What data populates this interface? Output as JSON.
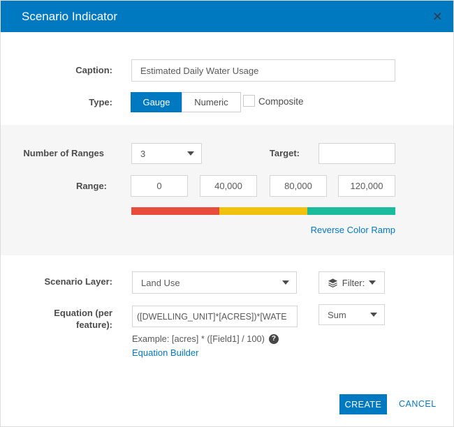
{
  "dialog": {
    "title": "Scenario Indicator",
    "close_glyph": "×"
  },
  "colors": {
    "accent": "#0079c1",
    "ramp_red": "#e74c3c",
    "ramp_yellow": "#f0c20e",
    "ramp_green": "#1abc9c",
    "panel_bg": "#f6f6f6"
  },
  "caption": {
    "label": "Caption:",
    "value": "Estimated Daily Water Usage"
  },
  "type": {
    "label": "Type:",
    "gauge_label": "Gauge",
    "numeric_label": "Numeric",
    "selected": "Gauge",
    "composite": {
      "label": "Composite",
      "checked": false
    }
  },
  "panel": {
    "number_of_ranges": {
      "label": "Number of Ranges",
      "value": "3"
    },
    "target": {
      "label": "Target:",
      "value": ""
    },
    "range": {
      "label": "Range:",
      "values": [
        "0",
        "40,000",
        "80,000",
        "120,000"
      ]
    },
    "reverse_link": "Reverse Color Ramp"
  },
  "layer": {
    "label": "Scenario Layer:",
    "value": "Land Use",
    "filter_label": "Filter:"
  },
  "equation": {
    "label": "Equation (per feature):",
    "value": "([DWELLING_UNIT]*[ACRES])*[WATE",
    "aggregation": "Sum",
    "example": "Example: [acres] * ([Field1] / 100)",
    "help_glyph": "?",
    "builder_link": "Equation Builder"
  },
  "footer": {
    "create_label": "CREATE",
    "cancel_label": "CANCEL"
  }
}
